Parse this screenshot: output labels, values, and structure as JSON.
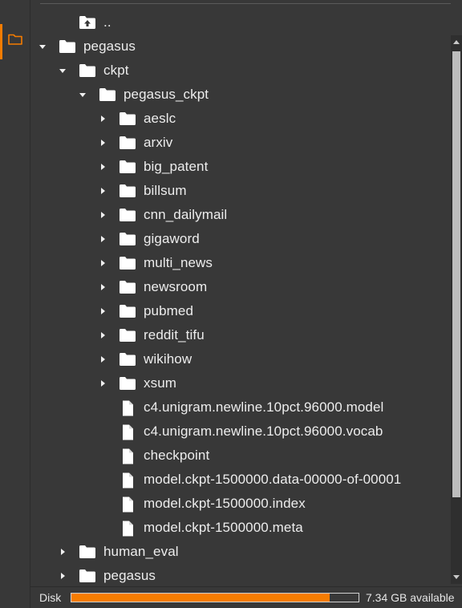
{
  "tree": [
    {
      "type": "up",
      "label": "..",
      "depth": 1
    },
    {
      "type": "folder",
      "label": "pegasus",
      "depth": 0,
      "expanded": true
    },
    {
      "type": "folder",
      "label": "ckpt",
      "depth": 1,
      "expanded": true
    },
    {
      "type": "folder",
      "label": "pegasus_ckpt",
      "depth": 2,
      "expanded": true
    },
    {
      "type": "folder",
      "label": "aeslc",
      "depth": 3,
      "expanded": false
    },
    {
      "type": "folder",
      "label": "arxiv",
      "depth": 3,
      "expanded": false
    },
    {
      "type": "folder",
      "label": "big_patent",
      "depth": 3,
      "expanded": false
    },
    {
      "type": "folder",
      "label": "billsum",
      "depth": 3,
      "expanded": false
    },
    {
      "type": "folder",
      "label": "cnn_dailymail",
      "depth": 3,
      "expanded": false
    },
    {
      "type": "folder",
      "label": "gigaword",
      "depth": 3,
      "expanded": false
    },
    {
      "type": "folder",
      "label": "multi_news",
      "depth": 3,
      "expanded": false
    },
    {
      "type": "folder",
      "label": "newsroom",
      "depth": 3,
      "expanded": false
    },
    {
      "type": "folder",
      "label": "pubmed",
      "depth": 3,
      "expanded": false
    },
    {
      "type": "folder",
      "label": "reddit_tifu",
      "depth": 3,
      "expanded": false
    },
    {
      "type": "folder",
      "label": "wikihow",
      "depth": 3,
      "expanded": false
    },
    {
      "type": "folder",
      "label": "xsum",
      "depth": 3,
      "expanded": false
    },
    {
      "type": "file",
      "label": "c4.unigram.newline.10pct.96000.model",
      "depth": 3
    },
    {
      "type": "file",
      "label": "c4.unigram.newline.10pct.96000.vocab",
      "depth": 3
    },
    {
      "type": "file",
      "label": "checkpoint",
      "depth": 3
    },
    {
      "type": "file",
      "label": "model.ckpt-1500000.data-00000-of-00001",
      "depth": 3
    },
    {
      "type": "file",
      "label": "model.ckpt-1500000.index",
      "depth": 3
    },
    {
      "type": "file",
      "label": "model.ckpt-1500000.meta",
      "depth": 3
    },
    {
      "type": "folder",
      "label": "human_eval",
      "depth": 1,
      "expanded": false
    },
    {
      "type": "folder",
      "label": "pegasus",
      "depth": 1,
      "expanded": false
    }
  ],
  "disk": {
    "label": "Disk",
    "available": "7.34 GB available",
    "used_fraction": 0.9
  },
  "colors": {
    "accent": "#f57c00",
    "background": "#383838",
    "icon": "#ffffff"
  },
  "icons": {
    "sidebar": "folder-outline-icon",
    "folder": "folder-icon",
    "file": "file-icon",
    "up": "folder-up-icon",
    "expanded": "caret-down-icon",
    "collapsed": "caret-right-icon"
  }
}
